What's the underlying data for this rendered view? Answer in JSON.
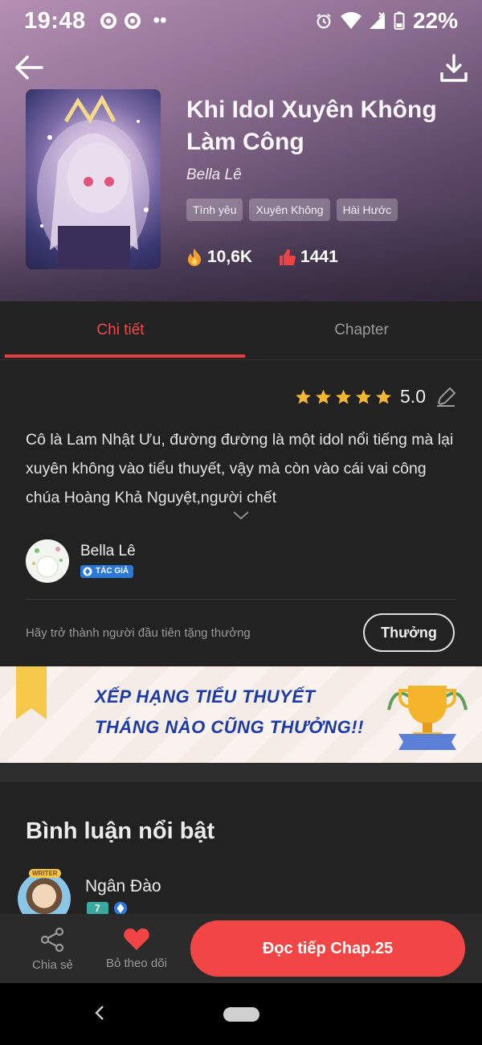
{
  "status_bar": {
    "time": "19:48",
    "battery": "22%"
  },
  "book": {
    "title": "Khi Idol Xuyên Không Làm Công",
    "author": "Bella Lê",
    "tags": [
      "Tình yêu",
      "Xuyên Không",
      "Hài Hước"
    ],
    "views": "10,6K",
    "likes": "1441"
  },
  "tabs": {
    "details": "Chi tiết",
    "chapter": "Chapter"
  },
  "rating": {
    "value": "5.0",
    "stars": 5
  },
  "description": "Cô là Lam Nhật Ưu, đường đường là một idol nổi tiếng mà lại xuyên không vào tiểu thuyết, vậy mà còn vào cái vai công chúa Hoàng Khả Nguyệt,người chết",
  "author_card": {
    "name": "Bella Lê",
    "badge": "TÁC GIẢ"
  },
  "reward": {
    "prompt": "Hãy trở thành người đầu tiên tặng thưởng",
    "button": "Thưởng"
  },
  "banner": {
    "line1": "XẾP HẠNG TIỂU THUYẾT",
    "line2": "THÁNG NÀO CŨNG THƯỞNG!!"
  },
  "comments": {
    "title": "Bình luận nổi bật",
    "first": {
      "name": "Ngân Đào",
      "avatar_label": "WRITER",
      "level": "7"
    }
  },
  "bottom_bar": {
    "share": "Chia sẻ",
    "unfollow": "Bỏ theo dõi",
    "read": "Đọc tiếp Chap.25"
  },
  "colors": {
    "accent": "#f24545",
    "background": "#222222",
    "banner_text": "#1c3aa6"
  }
}
